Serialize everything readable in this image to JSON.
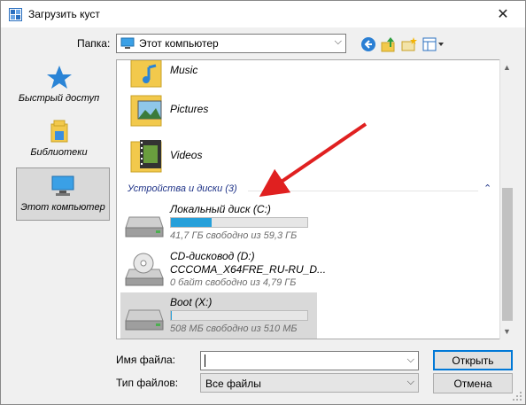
{
  "title": "Загрузить куст",
  "toolbar": {
    "folder_label": "Папка:",
    "folder_value": "Этот компьютер",
    "icons": [
      "back-icon",
      "up-folder-icon",
      "new-folder-icon",
      "view-menu-icon"
    ]
  },
  "places": [
    {
      "label": "Быстрый доступ",
      "icon": "star-icon"
    },
    {
      "label": "Библиотеки",
      "icon": "libraries-icon"
    },
    {
      "label": "Этот компьютер",
      "icon": "computer-icon",
      "selected": true
    }
  ],
  "folders": [
    {
      "name": "Music",
      "icon": "music-folder-icon"
    },
    {
      "name": "Pictures",
      "icon": "pictures-folder-icon"
    },
    {
      "name": "Videos",
      "icon": "videos-folder-icon"
    }
  ],
  "group": {
    "header": "Устройства и диски (3)"
  },
  "drives": [
    {
      "name": "Локальный диск (C:)",
      "free": "41,7 ГБ свободно из 59,3 ГБ",
      "used_fraction": 0.3,
      "icon": "hard-drive-icon"
    },
    {
      "name": "CD-дисковод (D:)",
      "name2": "CCCOMA_X64FRE_RU-RU_D...",
      "free": "0 байт свободно из 4,79 ГБ",
      "icon": "cd-drive-icon"
    },
    {
      "name": "Boot (X:)",
      "free": "508 МБ свободно из 510 МБ",
      "used_fraction": 0.004,
      "icon": "hard-drive-icon",
      "selected": true
    }
  ],
  "form": {
    "filename_label": "Имя файла:",
    "filename_value": "",
    "filetype_label": "Тип файлов:",
    "filetype_value": "Все файлы"
  },
  "buttons": {
    "open": "Открыть",
    "cancel": "Отмена"
  },
  "colors": {
    "accent": "#0078d7",
    "progress": "#26a0da",
    "annotation_arrow": "#e02020",
    "group_header": "#1e3287"
  }
}
